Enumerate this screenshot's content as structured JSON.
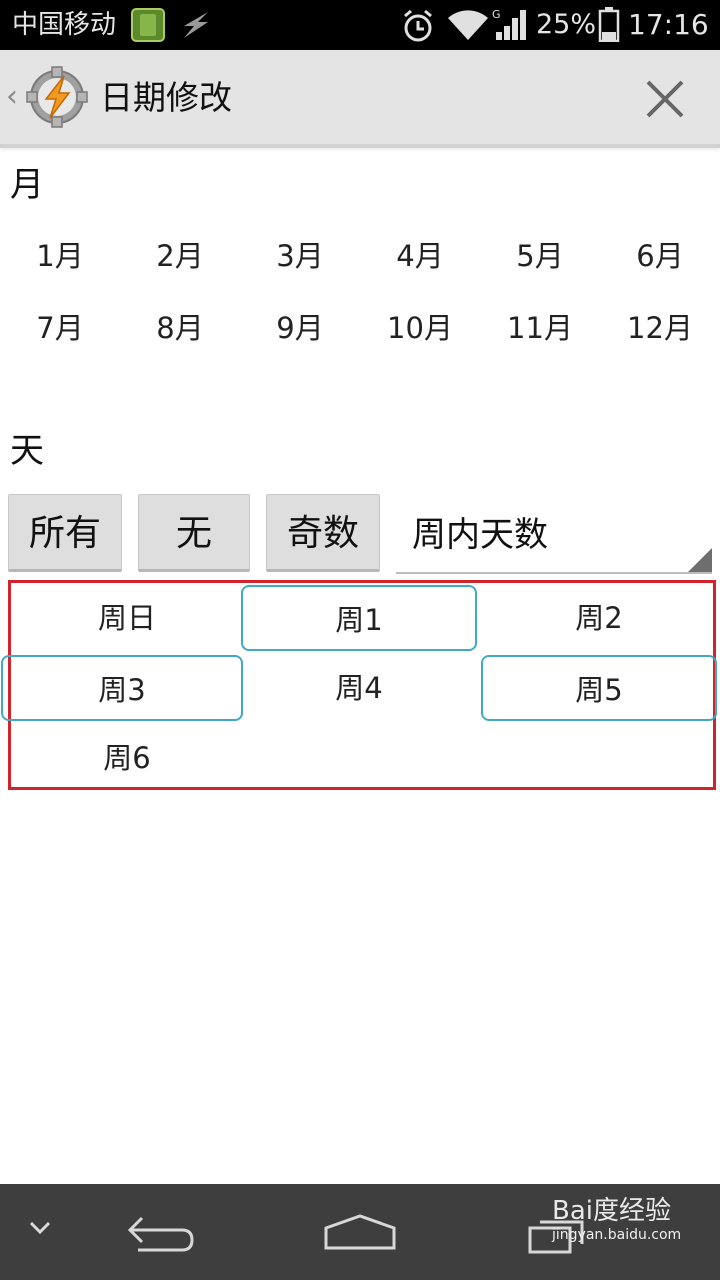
{
  "status_bar": {
    "carrier": "中国移动",
    "battery": "25%",
    "time": "17:16"
  },
  "app_bar": {
    "title": "日期修改"
  },
  "month_section": {
    "label": "月",
    "months": [
      "1月",
      "2月",
      "3月",
      "4月",
      "5月",
      "6月",
      "7月",
      "8月",
      "9月",
      "10月",
      "11月",
      "12月"
    ]
  },
  "day_section": {
    "label": "天",
    "buttons": {
      "all": "所有",
      "none": "无",
      "odd": "奇数"
    },
    "spinner_value": "周内天数",
    "days": [
      {
        "label": "周日",
        "selected": false
      },
      {
        "label": "周1",
        "selected": true
      },
      {
        "label": "周2",
        "selected": false
      },
      {
        "label": "周3",
        "selected": true
      },
      {
        "label": "周4",
        "selected": false
      },
      {
        "label": "周5",
        "selected": true
      },
      {
        "label": "周6",
        "selected": false
      }
    ]
  },
  "watermark": {
    "brand": "Bai度经验",
    "url": "jingyan.baidu.com"
  },
  "colors": {
    "highlight_box": "#d2232a",
    "selected_day_border": "#41a9c6",
    "app_bar": "#e4e4e4",
    "nav_bar": "#3e3e3e"
  }
}
